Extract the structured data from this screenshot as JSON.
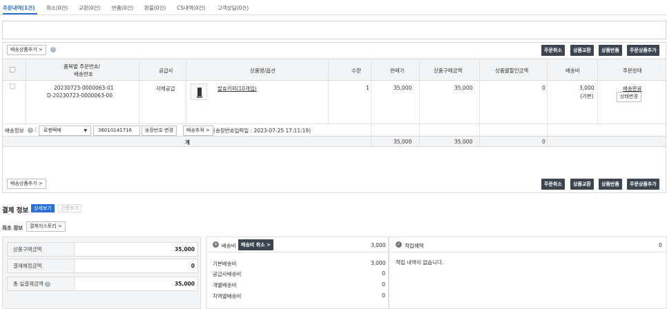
{
  "tabs": [
    {
      "label": "주문내역(1건)",
      "active": true
    },
    {
      "label": "취소(0건)"
    },
    {
      "label": "교환(0건)"
    },
    {
      "label": "반품(0건)"
    },
    {
      "label": "환불(0건)"
    },
    {
      "label": "CS내역(0건)"
    },
    {
      "label": "고객상담(0건)"
    }
  ],
  "toolbar": {
    "add_delivery": "배송상품추가 >",
    "order_cancel": "주문취소",
    "exchange": "상품교환",
    "return": "상품반품",
    "add_order_product": "주문상품추가"
  },
  "table": {
    "headers": {
      "order_no_line1": "품목별 주문번호/",
      "order_no_line2": "배송번호",
      "supplier": "공급사",
      "product": "상품명/옵션",
      "quantity": "수량",
      "price": "판매가",
      "purchase_amount": "상품구매금액",
      "discount": "상품별할인금액",
      "shipping_fee": "배송비",
      "order_status": "주문상태"
    },
    "row": {
      "order_no": "20230723-0000063-01",
      "delivery_no": "D-20230723-0000063-00",
      "supplier": "자체공급",
      "product_name": "발효커피(10개입)",
      "quantity": "1",
      "price": "35,000",
      "purchase_amount": "35,000",
      "discount": "0",
      "shipping_fee": "3,000",
      "shipping_type": "(기본)",
      "status": "배송완료",
      "status_change": "상태변경"
    },
    "delivery_info": {
      "label": "배송정보",
      "carrier": "로젠택배",
      "tracking_no": "36010141716",
      "change_tracking": "송장번호 변경",
      "track": "배송추적 >",
      "input_date": "(송장번호입력일 : 2023-07-25 17:11:19)"
    },
    "total": {
      "label": "계",
      "price": "35,000",
      "purchase_amount": "35,000",
      "discount": "0"
    }
  },
  "payment": {
    "title": "결제 정보",
    "detail_view": "상세보기",
    "simple_view": "간편보기",
    "initial_info": "최초 정보",
    "history": "결제히스토리 >",
    "purchase_amount_label": "상품구매금액",
    "purchase_amount": "35,000",
    "scheduled_label": "결제예정금액",
    "scheduled": "0",
    "total_paid_label": "총 실결제금액",
    "total_paid": "35,000",
    "shipping_label": "배송비",
    "shipping_cancel": "배송비 취소 >",
    "shipping_total": "3,000",
    "shipping_items": [
      {
        "label": "기본배송비",
        "value": "3,000"
      },
      {
        "label": "공급사배송비",
        "value": "0"
      },
      {
        "label": "개별배송비",
        "value": "0"
      },
      {
        "label": "지역별배송비",
        "value": "0"
      }
    ],
    "points_label": "적립혜택",
    "points_value": "0",
    "points_empty": "적립 내역이 없습니다."
  },
  "colors": {
    "accent": "#2a6fd6",
    "dark_button": "#3d4550"
  }
}
